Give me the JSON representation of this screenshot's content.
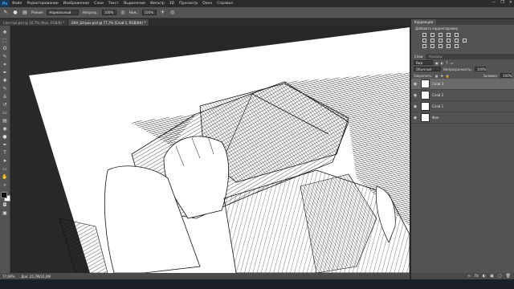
{
  "app": {
    "logo": "Ps"
  },
  "menu": [
    "Файл",
    "Редактирование",
    "Изображение",
    "Слои",
    "Текст",
    "Выделение",
    "Фильтр",
    "3D",
    "Просмотр",
    "Окно",
    "Справка"
  ],
  "window_buttons": [
    "—",
    "❐",
    "✕"
  ],
  "options": {
    "mode_label": "Режим:",
    "mode_value": "Нормальный",
    "opacity_label": "Непрозр.:",
    "opacity_value": "100%",
    "flow_label": "Наж.:",
    "flow_value": "100%"
  },
  "tabs": [
    {
      "label": "Светлая.psd @ 16,7% (Фон, RGB/8) *",
      "active": false
    },
    {
      "label": "ЕКА_Штрих.psd @ 77,7% (Слой 1, RGB/8#) *",
      "active": true
    }
  ],
  "tools": [
    "move-icon",
    "marquee-icon",
    "lasso-icon",
    "quick-select-icon",
    "crop-icon",
    "eyedropper-icon",
    "healing-icon",
    "brush-icon",
    "stamp-icon",
    "history-brush-icon",
    "eraser-icon",
    "gradient-icon",
    "blur-icon",
    "dodge-icon",
    "pen-icon",
    "type-icon",
    "path-select-icon",
    "shape-icon",
    "hand-icon",
    "zoom-icon"
  ],
  "tool_glyphs": [
    "✥",
    "⬚",
    "ʘ",
    "✎",
    "⌗",
    "✒",
    "✚",
    "✎",
    "♙",
    "↺",
    "▭",
    "▤",
    "◉",
    "●",
    "✒",
    "T",
    "➤",
    "▭",
    "✋",
    "⌕"
  ],
  "status": {
    "zoom": "77,69%",
    "doc": "Док: 25,7M/31,6M"
  },
  "panels": {
    "adjust_tab": "Коррекция",
    "adjust_title": "Добавить корректировку",
    "layers_tabs": [
      "Слои",
      "Каналы"
    ],
    "kind_value": "Вид",
    "blend_value": "Обычные",
    "opacity_label": "Непрозрачность:",
    "opacity_value": "100%",
    "lock_label": "Закрепить:",
    "fill_label": "Заливка:",
    "fill_value": "100%",
    "layers": [
      {
        "name": "Слой 3",
        "selected": true
      },
      {
        "name": "Слой 2",
        "selected": false
      },
      {
        "name": "Слой 1",
        "selected": false
      },
      {
        "name": "Фон",
        "selected": false
      }
    ],
    "footer_icons": [
      "∞",
      "fx",
      "◐",
      "▣",
      "▢",
      "🗑"
    ]
  },
  "colors": {
    "foreground": "#111111",
    "background": "#ffffff",
    "accent": "#31a8ff"
  }
}
